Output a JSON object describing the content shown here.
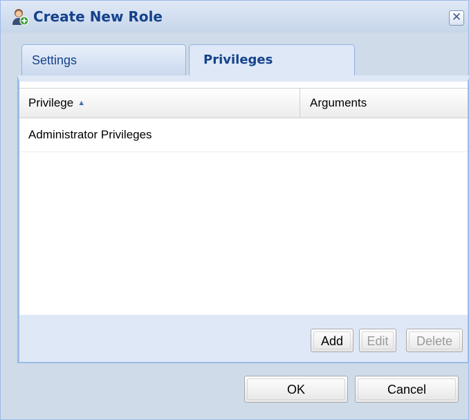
{
  "dialog": {
    "title": "Create New Role",
    "icon": "user-add-icon",
    "close_glyph": "✕"
  },
  "tabs": [
    {
      "label": "Settings",
      "active": false
    },
    {
      "label": "Privileges",
      "active": true
    }
  ],
  "grid": {
    "columns": [
      {
        "label": "Privilege",
        "sort": "ascending"
      },
      {
        "label": "Arguments"
      }
    ],
    "rows": [
      {
        "privilege": "Administrator Privileges",
        "arguments": ""
      }
    ],
    "sort_glyph": "▲"
  },
  "toolbar": {
    "add_label": "Add",
    "edit_label": "Edit",
    "delete_label": "Delete"
  },
  "footer": {
    "ok_label": "OK",
    "cancel_label": "Cancel"
  },
  "colors": {
    "title_text": "#15428b",
    "panel_border": "#99bbe8",
    "dialog_bg": "#cfdbe9"
  }
}
